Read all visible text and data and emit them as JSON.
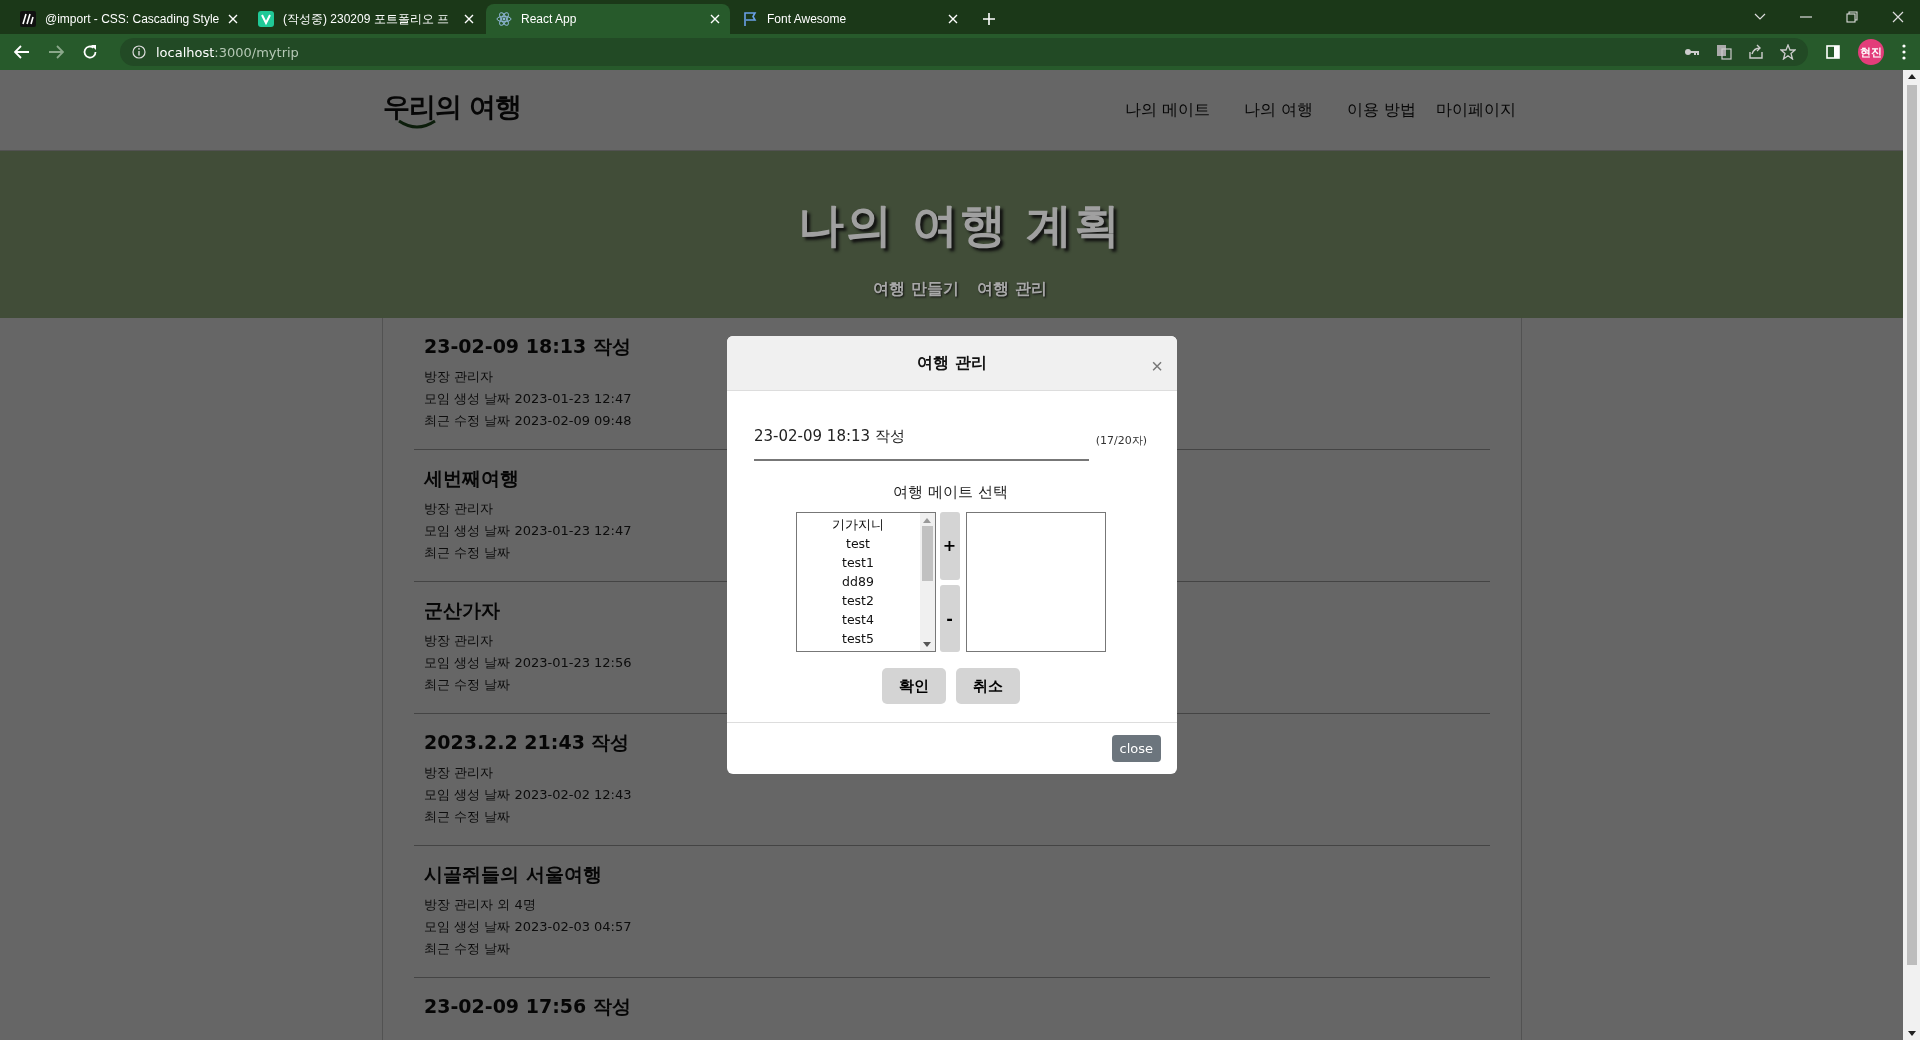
{
  "browser": {
    "tabs": [
      {
        "kind": "mdn",
        "title": "@import - CSS: Cascading Style",
        "selected": false
      },
      {
        "kind": "velog",
        "title": "(작성중) 230209 포트폴리오 프",
        "selected": false
      },
      {
        "kind": "react",
        "title": "React App",
        "selected": true
      },
      {
        "kind": "flag",
        "title": "Font Awesome",
        "selected": false
      }
    ],
    "address": {
      "host": "localhost",
      "path": ":3000/mytrip"
    },
    "profile": "현진"
  },
  "site": {
    "logo": "우리의 여행",
    "nav": [
      "나의 메이트",
      "나의 여행",
      "이용 방법",
      "마이페이지"
    ],
    "banner": {
      "title": "나의 여행 계획",
      "links": [
        "여행 만들기",
        "여행 관리"
      ]
    },
    "trips": [
      {
        "title": "23-02-09 18:13 작성",
        "owner": "방장 관리자",
        "created": "모임 생성 날짜 2023-01-23 12:47",
        "modified": "최근 수정 날짜 2023-02-09 09:48"
      },
      {
        "title": "세번째여행",
        "owner": "방장 관리자",
        "created": "모임 생성 날짜 2023-01-23 12:47",
        "modified": "최근 수정 날짜"
      },
      {
        "title": "군산가자",
        "owner": "방장 관리자",
        "created": "모임 생성 날짜 2023-01-23 12:56",
        "modified": "최근 수정 날짜"
      },
      {
        "title": "2023.2.2 21:43 작성",
        "owner": "방장 관리자",
        "created": "모임 생성 날짜 2023-02-02 12:43",
        "modified": "최근 수정 날짜"
      },
      {
        "title": "시골쥐들의 서울여행",
        "owner": "방장 관리자 외 4명",
        "created": "모임 생성 날짜 2023-02-03 04:57",
        "modified": "최근 수정 날짜"
      },
      {
        "title": "23-02-09 17:56 작성"
      }
    ]
  },
  "modal": {
    "title": "여행 관리",
    "close_icon": "×",
    "trip_name": "23-02-09 18:13 작성",
    "char_count": "(17/20자)",
    "mate_label": "여행 메이트 선택",
    "available_mates": [
      {
        "name": "기가지니",
        "selected": false
      },
      {
        "name": "test",
        "selected": false
      },
      {
        "name": "test1",
        "selected": false
      },
      {
        "name": "dd89",
        "selected": false
      },
      {
        "name": "test2",
        "selected": false
      },
      {
        "name": "test4",
        "selected": false
      },
      {
        "name": "test5",
        "selected": false
      }
    ],
    "add": "+",
    "remove": "-",
    "confirm": "확인",
    "cancel": "취소",
    "close": "close"
  }
}
